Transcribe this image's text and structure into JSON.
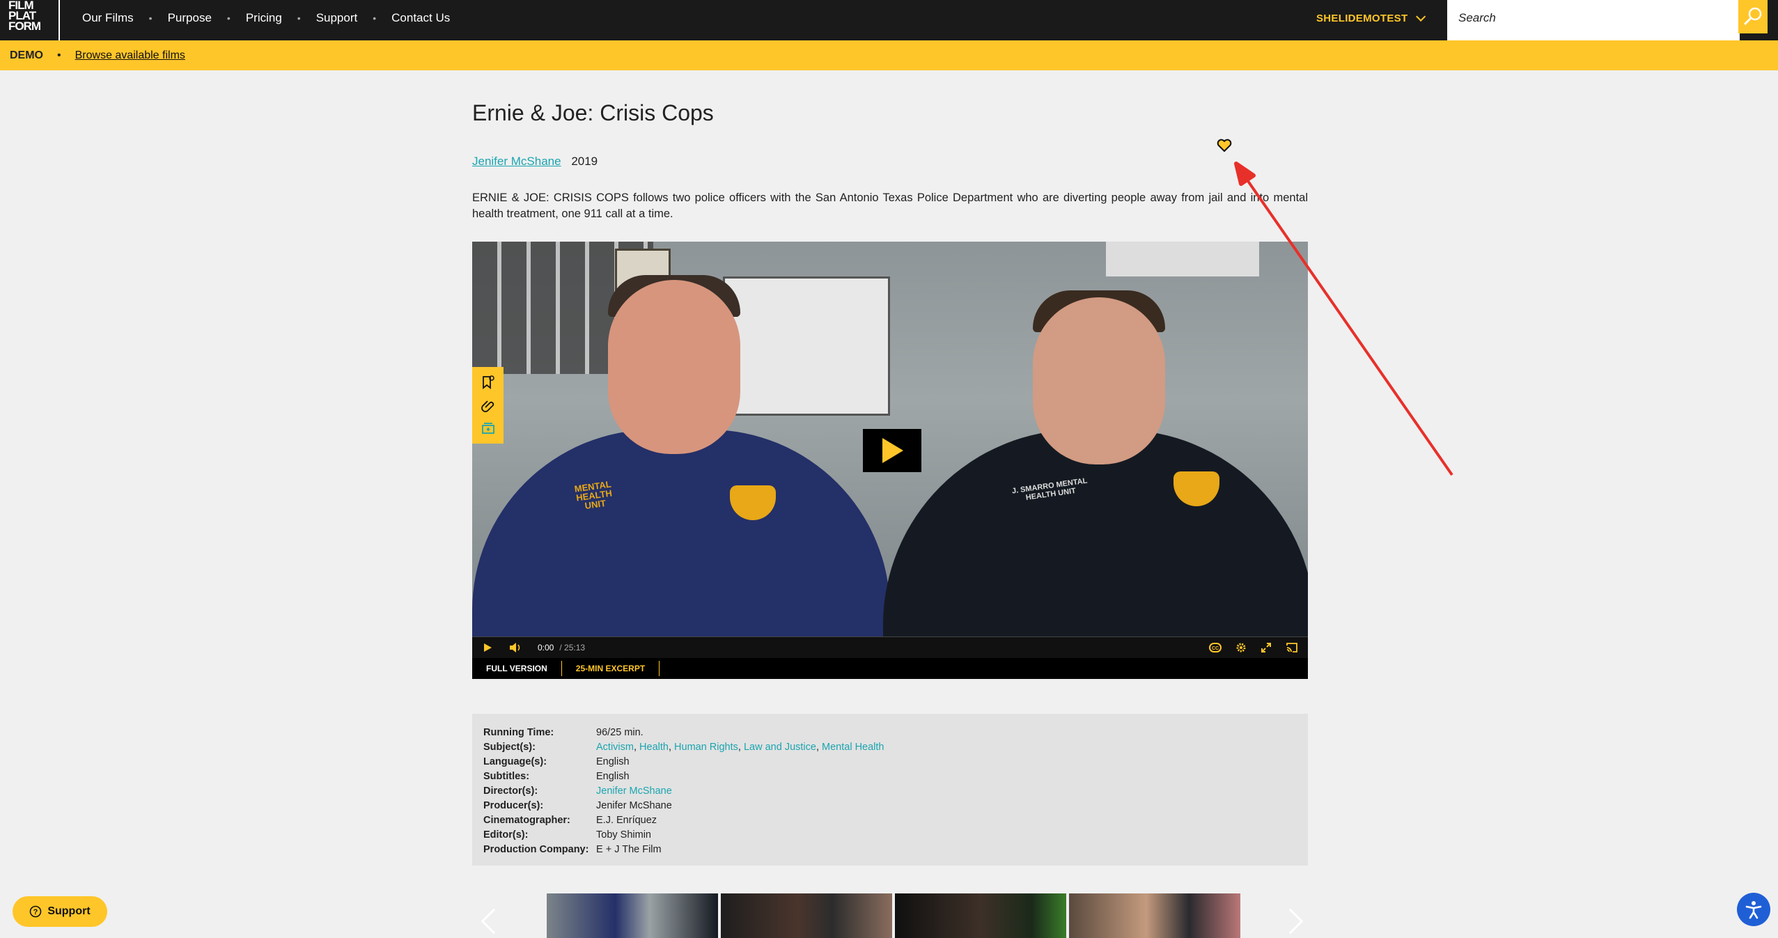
{
  "logo": {
    "lines": [
      "FILM",
      "PLAT",
      "FORM"
    ]
  },
  "nav": {
    "items": [
      {
        "label": "Our Films"
      },
      {
        "label": "Purpose"
      },
      {
        "label": "Pricing"
      },
      {
        "label": "Support"
      },
      {
        "label": "Contact Us"
      }
    ]
  },
  "account": {
    "name": "SHELIDEMOTEST"
  },
  "search": {
    "placeholder": "Search"
  },
  "demobar": {
    "label": "DEMO",
    "link": "Browse available films"
  },
  "film": {
    "title": "Ernie & Joe: Crisis Cops",
    "director": "Jenifer McShane",
    "year": "2019",
    "description": "ERNIE & JOE: CRISIS COPS follows two police officers with the San Antonio Texas Police Department who are diverting people away from jail and into mental health treatment, one 911 call at a time."
  },
  "player": {
    "current_time": "0:00",
    "duration": "/ 25:13",
    "versions": [
      "FULL VERSION",
      "25-MIN EXCERPT"
    ],
    "shirt_text_left": "MENTAL HEALTH UNIT",
    "shirt_text_right": "J. SMARRO MENTAL HEALTH UNIT"
  },
  "details": {
    "running_time": {
      "label": "Running Time:",
      "value": "96/25 min."
    },
    "subjects": {
      "label": "Subject(s):",
      "values": [
        "Activism",
        "Health",
        "Human Rights",
        "Law and Justice",
        "Mental Health"
      ]
    },
    "languages": {
      "label": "Language(s):",
      "value": "English"
    },
    "subtitles": {
      "label": "Subtitles:",
      "value": "English"
    },
    "directors": {
      "label": "Director(s):",
      "value": "Jenifer McShane"
    },
    "producers": {
      "label": "Producer(s):",
      "value": "Jenifer McShane"
    },
    "cinematographer": {
      "label": "Cinematographer:",
      "value": "E.J. Enríquez"
    },
    "editors": {
      "label": "Editor(s):",
      "value": "Toby Shimin"
    },
    "production_company": {
      "label": "Production Company:",
      "value": "E + J The Film"
    }
  },
  "support_button": {
    "label": "Support"
  },
  "colors": {
    "accent": "#ffc629",
    "link": "#1ba5b0",
    "nav_bg": "#1a1a1a",
    "annotation": "#e8302a",
    "accessibility": "#1f5fd6"
  }
}
